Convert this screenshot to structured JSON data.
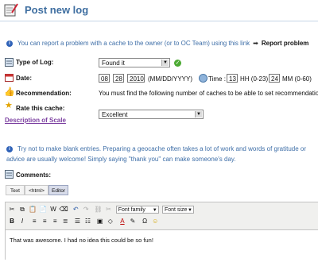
{
  "page": {
    "title": "Post new log"
  },
  "report": {
    "text": "You can report a problem with a cache to the owner (or to OC Team) using this link",
    "link": "Report problem"
  },
  "log_type": {
    "label": "Type of Log:",
    "value": "Found it"
  },
  "date": {
    "label": "Date:",
    "day": "08",
    "month": "28",
    "year": "2010",
    "format": "(MM/DD/YYYY)",
    "time_label": "Time :",
    "hour": "13",
    "hour_hint": "HH (0-23)",
    "minute": "24",
    "minute_hint": "MM (0-60)"
  },
  "recommendation": {
    "label": "Recommendation:",
    "text": "You must find the following number of caches to be able to set recommendations:"
  },
  "rating": {
    "label": "Rate this cache:",
    "scale_link": "Description of Scale",
    "value": "Excellent"
  },
  "advice": {
    "line1": "Try not to make blank entries. Preparing a geocache often takes a lot of work and words of gratitude or",
    "line2": "advice are usually welcome! Simply saying \"thank you\" can make someone's day."
  },
  "comments": {
    "label": "Comments:",
    "tabs": [
      "Text",
      "<html>",
      "Editor"
    ],
    "font_family": "Font family",
    "font_size": "Font size",
    "body": "That was awesome. I had no idea this could be so fun!"
  },
  "colors": {
    "accent": "#3e6ea0",
    "info": "#3f6fa8",
    "link": "#7b3fa0"
  }
}
